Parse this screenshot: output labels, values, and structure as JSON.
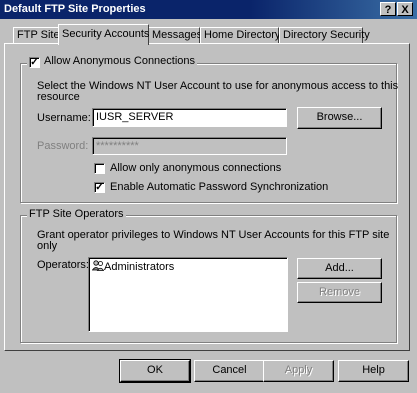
{
  "window": {
    "title": "Default FTP Site Properties",
    "help_glyph": "?",
    "close_glyph": "X"
  },
  "tabs": [
    {
      "label": "FTP Site",
      "active": false
    },
    {
      "label": "Security Accounts",
      "active": true
    },
    {
      "label": "Messages",
      "active": false
    },
    {
      "label": "Home Directory",
      "active": false
    },
    {
      "label": "Directory Security",
      "active": false
    }
  ],
  "anonymous": {
    "group_label": "Allow Anonymous Connections",
    "checked": true,
    "description_line1": "Select the Windows NT User Account to use for anonymous access to this",
    "description_line2": "resource",
    "username_label": "Username:",
    "username_value": "IUSR_SERVER",
    "browse_label": "Browse...",
    "password_label": "Password:",
    "password_value": "**********",
    "allow_only_anon_label": "Allow only anonymous connections",
    "allow_only_anon_checked": false,
    "enable_sync_label": "Enable Automatic Password Synchronization",
    "enable_sync_checked": true
  },
  "operators": {
    "group_label": "FTP Site Operators",
    "description_line1": "Grant operator privileges to Windows NT User Accounts for this FTP site",
    "description_line2": "only",
    "operators_label": "Operators:",
    "items": [
      "Administrators"
    ],
    "add_label": "Add...",
    "remove_label": "Remove"
  },
  "footer": {
    "ok_label": "OK",
    "cancel_label": "Cancel",
    "apply_label": "Apply",
    "help_label": "Help"
  }
}
